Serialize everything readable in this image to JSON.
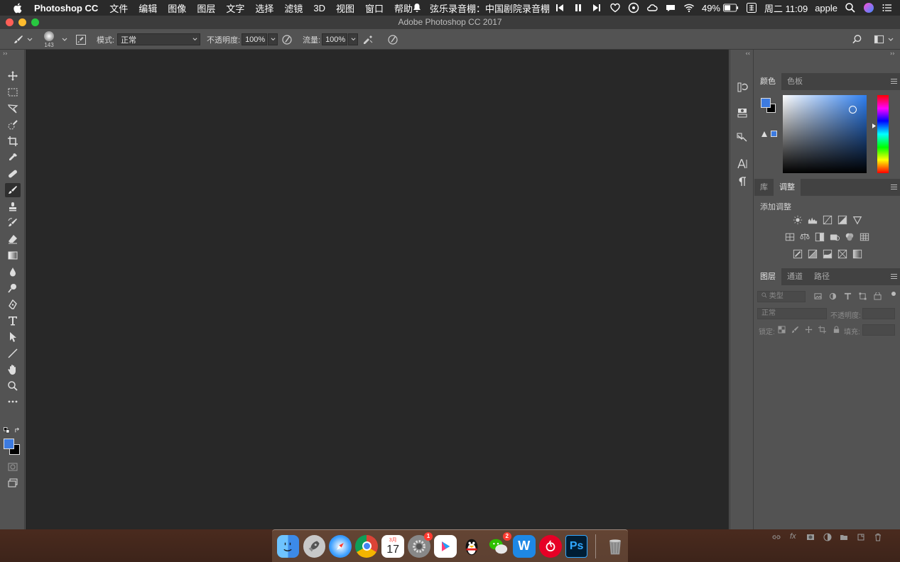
{
  "menubar": {
    "app_name": "Photoshop CC",
    "menus": [
      "文件",
      "编辑",
      "图像",
      "图层",
      "文字",
      "选择",
      "滤镜",
      "3D",
      "视图",
      "窗口",
      "帮助"
    ],
    "now_playing": "弦乐录音棚：中国剧院录音棚",
    "battery": "49%",
    "datetime": "周二 11:09",
    "user": "apple"
  },
  "window": {
    "title": "Adobe Photoshop CC 2017"
  },
  "options_bar": {
    "brush_size": "143",
    "mode_label": "模式:",
    "mode_value": "正常",
    "opacity_label": "不透明度:",
    "opacity_value": "100%",
    "flow_label": "流量:",
    "flow_value": "100%"
  },
  "panels": {
    "color_tabs": [
      "颜色",
      "色板"
    ],
    "adjust_tabs": [
      "库",
      "调整"
    ],
    "adjust_title": "添加调整",
    "layers_tabs": [
      "图层",
      "通道",
      "路径"
    ],
    "layers_filter_placeholder": "类型",
    "blend_mode": "正常",
    "opacity_label": "不透明度:",
    "lock_label": "锁定:",
    "fill_label": "填充:"
  },
  "colors": {
    "foreground": "#3d7be0",
    "background": "#000000",
    "canvas": "#282828",
    "ui": "#535353"
  },
  "dock": {
    "calendar_month": "3月",
    "calendar_day": "17",
    "settings_badge": "1",
    "wechat_badge": "2",
    "ps_label": "Ps",
    "wps_label": "W"
  }
}
